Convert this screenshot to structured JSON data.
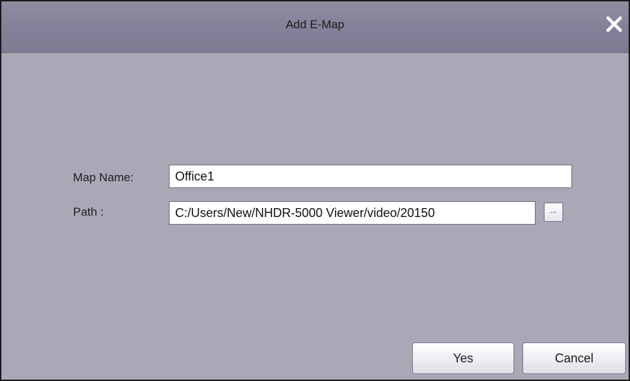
{
  "dialog": {
    "title": "Add E-Map",
    "close_icon": "close-icon"
  },
  "form": {
    "map_name_label": "Map Name:",
    "map_name_value": "Office1",
    "path_label": "Path :",
    "path_value": "C:/Users/New/NHDR-5000 Viewer/video/20150",
    "browse_label": "..."
  },
  "buttons": {
    "yes_label": "Yes",
    "cancel_label": "Cancel"
  }
}
